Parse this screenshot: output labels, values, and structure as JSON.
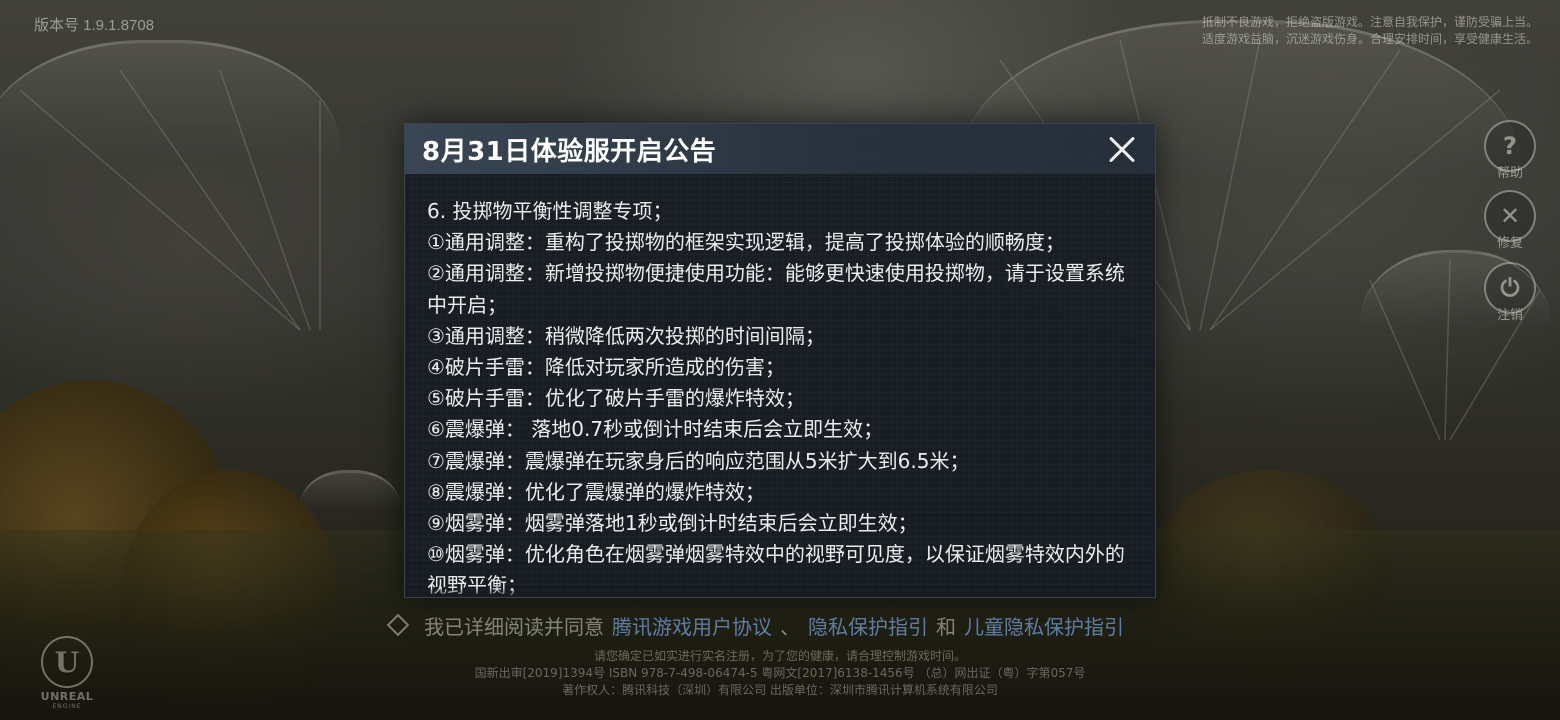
{
  "version_label": "版本号 1.9.1.8708",
  "health_notice": [
    "抵制不良游戏，拒绝盗版游戏。注意自我保护，谨防受骗上当。",
    "适度游戏益脑，沉迷游戏伤身。合理安排时间，享受健康生活。"
  ],
  "side_buttons": {
    "help": "帮助",
    "repair": "修复",
    "logout": "注销"
  },
  "modal": {
    "title": "8月31日体验服开启公告",
    "lines": [
      "6. 投掷物平衡性调整专项；",
      "①通用调整：重构了投掷物的框架实现逻辑，提高了投掷体验的顺畅度；",
      "②通用调整：新增投掷物便捷使用功能：能够更快速使用投掷物，请于设置系统中开启；",
      "③通用调整：稍微降低两次投掷的时间间隔；",
      "④破片手雷：降低对玩家所造成的伤害；",
      "⑤破片手雷：优化了破片手雷的爆炸特效；",
      "⑥震爆弹： 落地0.7秒或倒计时结束后会立即生效；",
      "⑦震爆弹：震爆弹在玩家身后的响应范围从5米扩大到6.5米；",
      "⑧震爆弹：优化了震爆弹的爆炸特效；",
      "⑨烟雾弹：烟雾弹落地1秒或倒计时结束后会立即生效；",
      "⑩烟雾弹：优化角色在烟雾弹烟雾特效中的视野可见度，以保证烟雾特效内外的视野平衡；"
    ]
  },
  "agreement": {
    "prefix": "我已详细阅读并同意",
    "link1": "腾讯游戏用户协议",
    "sep1": "、",
    "link2": "隐私保护指引",
    "and": "和",
    "link3": "儿童隐私保护指引"
  },
  "legal_lines": [
    "请您确定已如实进行实名注册，为了您的健康，请合理控制游戏时间。",
    "国新出审[2019]1394号  ISBN 978-7-498-06474-5  粤网文[2017]6138-1456号  （总）网出证（粤）字第057号",
    "著作权人：腾讯科技（深圳）有限公司   出版单位：深圳市腾讯计算机系统有限公司"
  ],
  "engine_logo": {
    "mark": "U",
    "name": "UNREAL",
    "sub": "ENGINE"
  }
}
